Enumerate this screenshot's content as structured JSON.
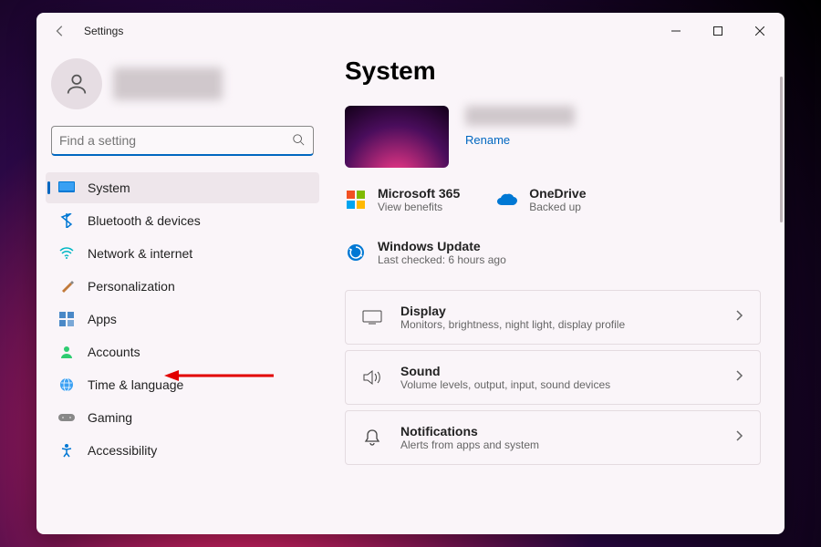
{
  "window": {
    "title": "Settings"
  },
  "search": {
    "placeholder": "Find a setting"
  },
  "nav": {
    "items": [
      {
        "label": "System"
      },
      {
        "label": "Bluetooth & devices"
      },
      {
        "label": "Network & internet"
      },
      {
        "label": "Personalization"
      },
      {
        "label": "Apps"
      },
      {
        "label": "Accounts"
      },
      {
        "label": "Time & language"
      },
      {
        "label": "Gaming"
      },
      {
        "label": "Accessibility"
      }
    ]
  },
  "main": {
    "heading": "System",
    "rename": "Rename",
    "tiles": {
      "m365": {
        "title": "Microsoft 365",
        "sub": "View benefits"
      },
      "onedrive": {
        "title": "OneDrive",
        "sub": "Backed up"
      },
      "update": {
        "title": "Windows Update",
        "sub": "Last checked: 6 hours ago"
      }
    },
    "cards": {
      "display": {
        "title": "Display",
        "sub": "Monitors, brightness, night light, display profile"
      },
      "sound": {
        "title": "Sound",
        "sub": "Volume levels, output, input, sound devices"
      },
      "notifications": {
        "title": "Notifications",
        "sub": "Alerts from apps and system"
      }
    }
  }
}
